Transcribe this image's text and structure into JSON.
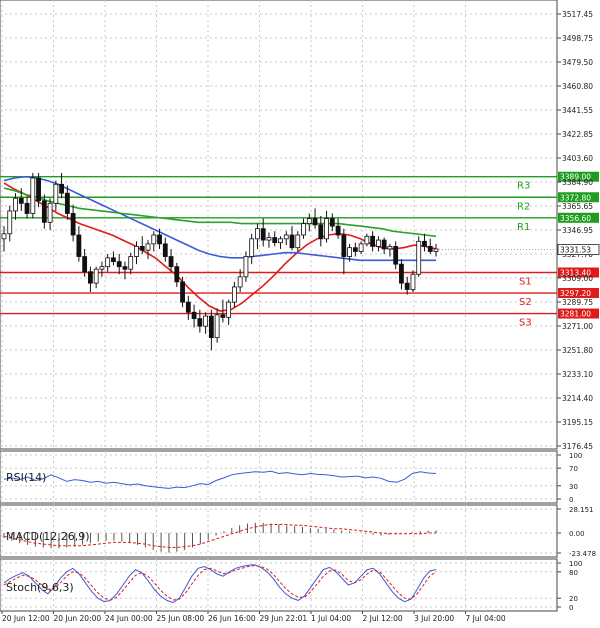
{
  "chart_data": [
    {
      "type": "candlestick",
      "title": "",
      "x_tick_labels": [
        "20 Jun 12:00",
        "20 Jun 20:00",
        "24 Jun 00:00",
        "25 Jun 08:00",
        "26 Jun 16:00",
        "29 Jun 22:01",
        "1 Jul 04:00",
        "2 Jul 12:00",
        "3 Jul 20:00",
        "7 Jul 04:00"
      ],
      "y_tick_labels": [
        "3517.45",
        "3498.75",
        "3479.50",
        "3460.80",
        "3441.55",
        "3422.85",
        "3403.60",
        "3384.90",
        "3365.65",
        "3346.95",
        "3327.70",
        "3309.00",
        "3289.75",
        "3271.00",
        "3251.80",
        "3233.10",
        "3214.40",
        "3195.15",
        "3176.45"
      ],
      "ylim": [
        3176.45,
        3517.45
      ],
      "grid": true,
      "current_price": 3331.53,
      "current_price_label": "3331.53",
      "levels": [
        {
          "name": "R3",
          "value": 3389.0,
          "value_label": "3389.00",
          "color": "#1f9d1f"
        },
        {
          "name": "R2",
          "value": 3372.8,
          "value_label": "3372.80",
          "color": "#1f9d1f"
        },
        {
          "name": "R1",
          "value": 3356.6,
          "value_label": "3356.60",
          "color": "#1f9d1f"
        },
        {
          "name": "S1",
          "value": 3313.4,
          "value_label": "3313.40",
          "color": "#e01b1b"
        },
        {
          "name": "S2",
          "value": 3297.2,
          "value_label": "3297.20",
          "color": "#e01b1b"
        },
        {
          "name": "S3",
          "value": 3281.0,
          "value_label": "3281.00",
          "color": "#e01b1b"
        }
      ],
      "candles": [
        {
          "o": 3340,
          "h": 3350,
          "l": 3330,
          "c": 3344
        },
        {
          "o": 3344,
          "h": 3366,
          "l": 3338,
          "c": 3362
        },
        {
          "o": 3362,
          "h": 3376,
          "l": 3355,
          "c": 3372
        },
        {
          "o": 3372,
          "h": 3380,
          "l": 3362,
          "c": 3368
        },
        {
          "o": 3368,
          "h": 3373,
          "l": 3356,
          "c": 3360
        },
        {
          "o": 3360,
          "h": 3392,
          "l": 3356,
          "c": 3388
        },
        {
          "o": 3388,
          "h": 3392,
          "l": 3365,
          "c": 3370
        },
        {
          "o": 3370,
          "h": 3375,
          "l": 3348,
          "c": 3353
        },
        {
          "o": 3353,
          "h": 3372,
          "l": 3347,
          "c": 3368
        },
        {
          "o": 3368,
          "h": 3386,
          "l": 3362,
          "c": 3383
        },
        {
          "o": 3383,
          "h": 3392,
          "l": 3372,
          "c": 3376
        },
        {
          "o": 3376,
          "h": 3382,
          "l": 3355,
          "c": 3360
        },
        {
          "o": 3360,
          "h": 3367,
          "l": 3338,
          "c": 3343
        },
        {
          "o": 3343,
          "h": 3350,
          "l": 3322,
          "c": 3326
        },
        {
          "o": 3326,
          "h": 3332,
          "l": 3310,
          "c": 3314
        },
        {
          "o": 3314,
          "h": 3318,
          "l": 3298,
          "c": 3305
        },
        {
          "o": 3305,
          "h": 3318,
          "l": 3301,
          "c": 3316
        },
        {
          "o": 3316,
          "h": 3322,
          "l": 3310,
          "c": 3318
        },
        {
          "o": 3318,
          "h": 3328,
          "l": 3314,
          "c": 3325
        },
        {
          "o": 3325,
          "h": 3330,
          "l": 3319,
          "c": 3322
        },
        {
          "o": 3322,
          "h": 3328,
          "l": 3312,
          "c": 3318
        },
        {
          "o": 3318,
          "h": 3322,
          "l": 3308,
          "c": 3316
        },
        {
          "o": 3316,
          "h": 3329,
          "l": 3312,
          "c": 3326
        },
        {
          "o": 3326,
          "h": 3338,
          "l": 3320,
          "c": 3334
        },
        {
          "o": 3334,
          "h": 3342,
          "l": 3328,
          "c": 3331
        },
        {
          "o": 3331,
          "h": 3339,
          "l": 3324,
          "c": 3336
        },
        {
          "o": 3336,
          "h": 3346,
          "l": 3330,
          "c": 3343
        },
        {
          "o": 3343,
          "h": 3348,
          "l": 3332,
          "c": 3336
        },
        {
          "o": 3336,
          "h": 3341,
          "l": 3322,
          "c": 3326
        },
        {
          "o": 3326,
          "h": 3332,
          "l": 3314,
          "c": 3318
        },
        {
          "o": 3318,
          "h": 3321,
          "l": 3302,
          "c": 3306
        },
        {
          "o": 3306,
          "h": 3310,
          "l": 3286,
          "c": 3290
        },
        {
          "o": 3290,
          "h": 3295,
          "l": 3276,
          "c": 3282
        },
        {
          "o": 3282,
          "h": 3288,
          "l": 3270,
          "c": 3277
        },
        {
          "o": 3277,
          "h": 3284,
          "l": 3266,
          "c": 3271
        },
        {
          "o": 3271,
          "h": 3282,
          "l": 3265,
          "c": 3279
        },
        {
          "o": 3279,
          "h": 3284,
          "l": 3252,
          "c": 3262
        },
        {
          "o": 3262,
          "h": 3285,
          "l": 3258,
          "c": 3280
        },
        {
          "o": 3280,
          "h": 3292,
          "l": 3274,
          "c": 3278
        },
        {
          "o": 3278,
          "h": 3292,
          "l": 3272,
          "c": 3290
        },
        {
          "o": 3290,
          "h": 3306,
          "l": 3286,
          "c": 3302
        },
        {
          "o": 3302,
          "h": 3316,
          "l": 3298,
          "c": 3310
        },
        {
          "o": 3310,
          "h": 3330,
          "l": 3306,
          "c": 3326
        },
        {
          "o": 3326,
          "h": 3344,
          "l": 3320,
          "c": 3340
        },
        {
          "o": 3340,
          "h": 3352,
          "l": 3332,
          "c": 3348
        },
        {
          "o": 3348,
          "h": 3356,
          "l": 3334,
          "c": 3339
        },
        {
          "o": 3339,
          "h": 3345,
          "l": 3333,
          "c": 3341
        },
        {
          "o": 3341,
          "h": 3346,
          "l": 3334,
          "c": 3337
        },
        {
          "o": 3337,
          "h": 3342,
          "l": 3332,
          "c": 3340
        },
        {
          "o": 3340,
          "h": 3346,
          "l": 3335,
          "c": 3343
        },
        {
          "o": 3343,
          "h": 3350,
          "l": 3331,
          "c": 3333
        },
        {
          "o": 3333,
          "h": 3346,
          "l": 3330,
          "c": 3343
        },
        {
          "o": 3343,
          "h": 3356,
          "l": 3340,
          "c": 3352
        },
        {
          "o": 3352,
          "h": 3360,
          "l": 3346,
          "c": 3356
        },
        {
          "o": 3356,
          "h": 3364,
          "l": 3348,
          "c": 3351
        },
        {
          "o": 3351,
          "h": 3358,
          "l": 3334,
          "c": 3340
        },
        {
          "o": 3340,
          "h": 3362,
          "l": 3337,
          "c": 3356
        },
        {
          "o": 3356,
          "h": 3360,
          "l": 3346,
          "c": 3350
        },
        {
          "o": 3350,
          "h": 3356,
          "l": 3340,
          "c": 3343
        },
        {
          "o": 3343,
          "h": 3348,
          "l": 3312,
          "c": 3326
        },
        {
          "o": 3326,
          "h": 3336,
          "l": 3322,
          "c": 3333
        },
        {
          "o": 3333,
          "h": 3337,
          "l": 3326,
          "c": 3330
        },
        {
          "o": 3330,
          "h": 3338,
          "l": 3328,
          "c": 3336
        },
        {
          "o": 3336,
          "h": 3344,
          "l": 3334,
          "c": 3342
        },
        {
          "o": 3342,
          "h": 3346,
          "l": 3330,
          "c": 3334
        },
        {
          "o": 3334,
          "h": 3342,
          "l": 3330,
          "c": 3339
        },
        {
          "o": 3339,
          "h": 3341,
          "l": 3328,
          "c": 3332
        },
        {
          "o": 3332,
          "h": 3336,
          "l": 3326,
          "c": 3334
        },
        {
          "o": 3334,
          "h": 3338,
          "l": 3316,
          "c": 3320
        },
        {
          "o": 3320,
          "h": 3324,
          "l": 3300,
          "c": 3305
        },
        {
          "o": 3305,
          "h": 3310,
          "l": 3296,
          "c": 3300
        },
        {
          "o": 3300,
          "h": 3315,
          "l": 3298,
          "c": 3312
        },
        {
          "o": 3312,
          "h": 3342,
          "l": 3310,
          "c": 3338
        },
        {
          "o": 3338,
          "h": 3344,
          "l": 3330,
          "c": 3334
        },
        {
          "o": 3334,
          "h": 3340,
          "l": 3328,
          "c": 3330
        },
        {
          "o": 3330,
          "h": 3336,
          "l": 3326,
          "c": 3332
        }
      ],
      "series": [
        {
          "name": "",
          "color": "#e01b1b",
          "values": [
            3384,
            3379,
            3375,
            3370,
            3365,
            3360,
            3356,
            3352,
            3349,
            3346,
            3343,
            3339,
            3335,
            3330,
            3325,
            3318,
            3311,
            3302,
            3294,
            3287,
            3283,
            3284,
            3289,
            3296,
            3303,
            3311,
            3320,
            3328,
            3335,
            3340,
            3343,
            3344,
            3343,
            3340,
            3336,
            3333,
            3332,
            3333,
            3335,
            3334,
            3332
          ]
        },
        {
          "name": "",
          "color": "#3a5bd9",
          "values": [
            3386,
            3388,
            3389,
            3388,
            3386,
            3383,
            3379,
            3375,
            3371,
            3367,
            3363,
            3359,
            3355,
            3351,
            3347,
            3343,
            3339,
            3335,
            3331,
            3328,
            3326,
            3325,
            3325,
            3326,
            3327,
            3328,
            3329,
            3329,
            3328,
            3327,
            3326,
            3325,
            3324,
            3323,
            3323,
            3323,
            3323,
            3323,
            3323,
            3323,
            3323
          ]
        },
        {
          "name": "",
          "color": "#2ca02c",
          "values": [
            3380,
            3378,
            3375,
            3373,
            3370,
            3368,
            3366,
            3364,
            3363,
            3362,
            3361,
            3360,
            3359,
            3358,
            3357,
            3356,
            3355,
            3354,
            3353,
            3353,
            3353,
            3353,
            3352,
            3352,
            3352,
            3352,
            3352,
            3352,
            3352,
            3352,
            3352,
            3352,
            3351,
            3350,
            3349,
            3348,
            3346,
            3345,
            3344,
            3343,
            3342
          ]
        }
      ]
    },
    {
      "type": "line",
      "label": "RSI(14)",
      "y_tick_labels": [
        "100",
        "70",
        "30",
        "0"
      ],
      "ylim": [
        0,
        100
      ],
      "series": [
        {
          "name": "",
          "color": "#3a5bd9",
          "values": [
            45,
            48,
            44,
            50,
            42,
            46,
            55,
            48,
            40,
            44,
            42,
            38,
            40,
            36,
            38,
            35,
            32,
            34,
            30,
            28,
            26,
            24,
            27,
            26,
            30,
            35,
            33,
            42,
            48,
            55,
            58,
            60,
            62,
            61,
            63,
            58,
            60,
            57,
            55,
            58,
            56,
            55,
            53,
            50,
            51,
            52,
            48,
            50,
            47,
            40,
            38,
            45,
            58,
            62,
            59,
            58
          ]
        }
      ]
    },
    {
      "type": "bar+line",
      "label": "MACD(12,26,9)",
      "y_tick_labels": [
        "28.151",
        "0.00",
        "-23.478"
      ],
      "ylim": [
        -23.478,
        28.151
      ],
      "bars": [
        -6,
        -9,
        -12,
        -14,
        -16,
        -17,
        -18,
        -18,
        -17,
        -16,
        -14,
        -12,
        -10,
        -9,
        -9,
        -10,
        -12,
        -14,
        -17,
        -20,
        -22,
        -23,
        -22,
        -20,
        -17,
        -13,
        -8,
        -3,
        2,
        6,
        9,
        11,
        12,
        12,
        11,
        10,
        9,
        8,
        7,
        6,
        5,
        5,
        4,
        3,
        2,
        0,
        -1,
        -2,
        -3,
        -2,
        -1,
        0,
        1,
        2,
        3,
        3
      ],
      "series": [
        {
          "name": "",
          "color": "#e01b1b",
          "values": [
            -4,
            -6,
            -8,
            -10,
            -12,
            -13,
            -14,
            -15,
            -15,
            -15,
            -15,
            -14,
            -13,
            -12,
            -11,
            -11,
            -11,
            -12,
            -13,
            -15,
            -16,
            -17,
            -17,
            -16,
            -15,
            -13,
            -10,
            -7,
            -4,
            -1,
            2,
            5,
            7,
            9,
            10,
            10,
            10,
            9,
            9,
            8,
            7,
            6,
            5,
            5,
            4,
            3,
            2,
            1,
            0,
            -1,
            -1,
            -1,
            -1,
            -1,
            0,
            0
          ]
        }
      ]
    },
    {
      "type": "line",
      "label": "Stoch(9,6,3)",
      "y_tick_labels": [
        "100",
        "80",
        "20",
        "0"
      ],
      "ylim": [
        0,
        100
      ],
      "series": [
        {
          "name": "",
          "color": "#3a5bd9",
          "values": [
            55,
            65,
            72,
            78,
            70,
            55,
            40,
            30,
            45,
            65,
            80,
            88,
            75,
            55,
            35,
            20,
            12,
            15,
            30,
            50,
            70,
            85,
            78,
            60,
            40,
            25,
            15,
            10,
            20,
            45,
            70,
            88,
            92,
            85,
            75,
            70,
            80,
            88,
            92,
            95,
            96,
            90,
            80,
            65,
            45,
            30,
            20,
            15,
            25,
            45,
            65,
            85,
            90,
            80,
            65,
            50,
            55,
            70,
            85,
            88,
            75,
            55,
            35,
            20,
            12,
            18,
            40,
            65,
            82,
            85
          ]
        },
        {
          "name": "",
          "color": "#e01b1b",
          "values": [
            50,
            58,
            66,
            72,
            70,
            62,
            50,
            40,
            42,
            55,
            70,
            80,
            78,
            65,
            48,
            32,
            20,
            16,
            22,
            38,
            55,
            72,
            78,
            70,
            55,
            38,
            25,
            16,
            18,
            32,
            52,
            72,
            85,
            88,
            82,
            76,
            78,
            84,
            88,
            92,
            94,
            92,
            86,
            75,
            58,
            42,
            30,
            22,
            22,
            35,
            52,
            70,
            82,
            84,
            74,
            60,
            55,
            62,
            75,
            84,
            80,
            65,
            48,
            32,
            20,
            18,
            30,
            50,
            70,
            80
          ]
        }
      ]
    }
  ]
}
